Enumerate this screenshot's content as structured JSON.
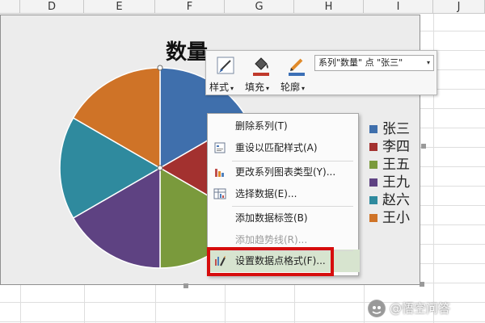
{
  "sheet": {
    "columns": [
      "D",
      "E",
      "F",
      "G",
      "H",
      "I",
      "J"
    ]
  },
  "chart": {
    "title": "数量",
    "legend": [
      {
        "label": "张三",
        "color": "#3f6fac"
      },
      {
        "label": "李四",
        "color": "#a3312f"
      },
      {
        "label": "王五",
        "color": "#7a9a3c"
      },
      {
        "label": "王九",
        "color": "#5e4282"
      },
      {
        "label": "赵六",
        "color": "#2f8a9e"
      },
      {
        "label": "王小",
        "color": "#cf7327"
      }
    ]
  },
  "chart_data": {
    "type": "pie",
    "title": "数量",
    "categories": [
      "张三",
      "李四",
      "王五",
      "王九",
      "赵六",
      "王小"
    ],
    "values": [
      1,
      1,
      1,
      1,
      1,
      1
    ],
    "colors": [
      "#3f6fac",
      "#a3312f",
      "#7a9a3c",
      "#5e4282",
      "#2f8a9e",
      "#cf7327"
    ],
    "legend_position": "right"
  },
  "toolbar": {
    "style_label": "样式",
    "fill_label": "填充",
    "outline_label": "轮廓",
    "series_select_value": "系列\"数量\" 点 \"张三\"",
    "icons": [
      "brush-icon",
      "paint-bucket-icon",
      "pencil-icon"
    ]
  },
  "context_menu": {
    "items": [
      {
        "label": "删除系列(T)",
        "icon": "",
        "disabled": false
      },
      {
        "label": "重设以匹配样式(A)",
        "icon": "reset-style-icon",
        "disabled": false
      },
      {
        "label": "更改系列图表类型(Y)...",
        "icon": "chart-type-icon",
        "disabled": false
      },
      {
        "label": "选择数据(E)...",
        "icon": "select-data-icon",
        "disabled": false
      },
      {
        "label": "添加数据标签(B)",
        "icon": "",
        "disabled": false
      },
      {
        "label": "添加趋势线(R)...",
        "icon": "",
        "disabled": true
      },
      {
        "label": "设置数据点格式(F)...",
        "icon": "format-data-point-icon",
        "disabled": false
      }
    ]
  },
  "watermark": {
    "text": "@悟空问答",
    "icon": "wukong-logo-icon"
  }
}
